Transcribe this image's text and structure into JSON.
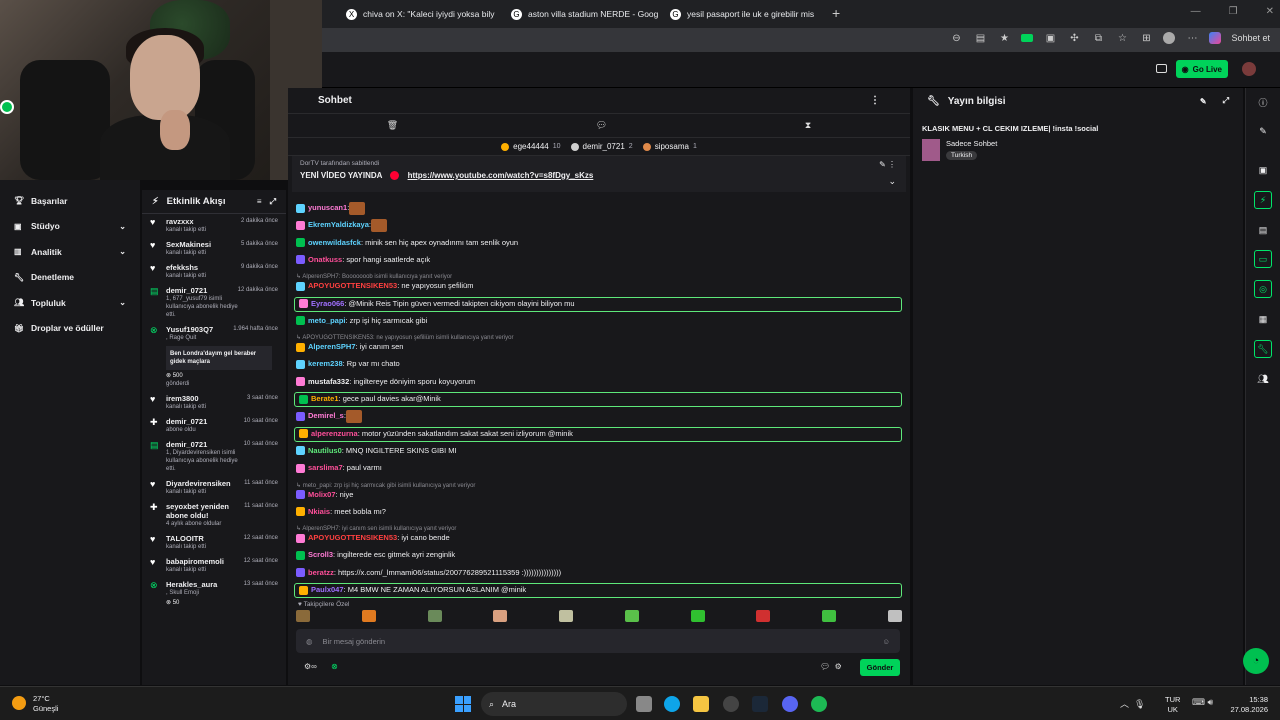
{
  "browser": {
    "tabs": [
      {
        "label": "chiva on X: \"Kaleci iyiydi yoksa bily",
        "icon": "x-icon"
      },
      {
        "label": "aston villa stadium NERDE - Goog",
        "icon": "google-icon"
      },
      {
        "label": "yesil pasaport ile uk e girebilir mis",
        "icon": "google-icon"
      }
    ],
    "new_tab": "+",
    "profile_label": "Sohbet et"
  },
  "header": {
    "go_live": "Go Live"
  },
  "sidebar": {
    "items": [
      {
        "label": "Başarılar",
        "icon": "trophy-icon",
        "chevron": false
      },
      {
        "label": "Stüdyo",
        "icon": "studio-icon",
        "chevron": true
      },
      {
        "label": "Analitik",
        "icon": "chart-icon",
        "chevron": true
      },
      {
        "label": "Denetleme",
        "icon": "wrench-icon",
        "chevron": false
      },
      {
        "label": "Topluluk",
        "icon": "community-icon",
        "chevron": true
      },
      {
        "label": "Droplar ve ödüller",
        "icon": "gift-icon",
        "chevron": false
      }
    ]
  },
  "feed": {
    "title": "Etkinlik Akışı",
    "items": [
      {
        "icon": "heart-icon",
        "name": "ravzxxx",
        "sub": "kanalı takip etti",
        "time": "2 dakika önce"
      },
      {
        "icon": "heart-icon",
        "name": "SexMakinesi",
        "sub": "kanalı takip etti",
        "time": "5 dakika önce"
      },
      {
        "icon": "heart-icon",
        "name": "efekkshs",
        "sub": "kanalı takip etti",
        "time": "9 dakika önce"
      },
      {
        "icon": "gift-icon",
        "name": "demir_0721",
        "sub": "1, 677_yusuf79 isimli kullanıcıya abonelik hediye etti.",
        "time": "12 dakika önce"
      },
      {
        "icon": "bits-icon",
        "name": "Yusuf1903Q7",
        "sub": ", Rage Quit",
        "time": "1.964 hafta önce",
        "message": "Ben Londra'dayım gel beraber gidek maçlara",
        "amount": "500",
        "note": "gönderdi"
      },
      {
        "icon": "heart-icon",
        "name": "irem3800",
        "sub": "kanalı takip etti",
        "time": "3 saat önce"
      },
      {
        "icon": "star-icon",
        "name": "demir_0721",
        "sub": "abone oldu",
        "time": "10 saat önce"
      },
      {
        "icon": "gift-icon",
        "name": "demir_0721",
        "sub": "1, Diyardeviren­siken isimli kullanıcıya abonelik hediye etti.",
        "time": "10 saat önce"
      },
      {
        "icon": "heart-icon",
        "name": "Diyardevirensiken",
        "sub": "kanalı takip etti",
        "time": "11 saat önce"
      },
      {
        "icon": "star-icon",
        "name": "seyoxbet yeniden abone oldu!",
        "sub": "4 aylık abone oldular",
        "time": "11 saat önce"
      },
      {
        "icon": "heart-icon",
        "name": "TALOOITR",
        "sub": "kanalı takip etti",
        "time": "12 saat önce"
      },
      {
        "icon": "heart-icon",
        "name": "babapiromemoli",
        "sub": "kanalı takip etti",
        "time": "12 saat önce"
      },
      {
        "icon": "bits-icon",
        "name": "Herakles_aura",
        "sub": ", Skull Emoji",
        "time": "13 saat önce",
        "amount": "50"
      }
    ]
  },
  "chat": {
    "title": "Sohbet",
    "leaders": [
      {
        "name": "ege44444",
        "count": "10"
      },
      {
        "name": "demir_0721",
        "count": "2"
      },
      {
        "name": "siposama",
        "count": "1"
      }
    ],
    "pinned_by": "DorTV tarafından sabitlendi",
    "pinned_title": "YENİ VİDEO YAYINDA",
    "pinned_link": "https://www.youtube.com/watch?v=s8fDgy_sKzs",
    "messages": [
      {
        "user": "yunuscan1",
        "color": "#ff7bd5",
        "text": ":",
        "emote": true,
        "type": "normal"
      },
      {
        "user": "EkremYaldizkaya",
        "color": "#5ed3ff",
        "text": ":",
        "emote": true,
        "type": "normal"
      },
      {
        "user": "owenwildasfck",
        "color": "#5ed3ff",
        "text": ": minik sen hiç apex oynadınmı tam senlik oyun",
        "type": "normal"
      },
      {
        "user": "Onatkuss",
        "color": "#ff4f9a",
        "text": ": spor hangi saatlerde açık",
        "type": "normal"
      },
      {
        "user": "",
        "color": "",
        "text": "↳ AlperenSPH7: Booooooob isimli kullanıcıya yanıt veriyor",
        "type": "reply"
      },
      {
        "user": "APOYUGOTTENSIKEN53",
        "color": "#ff4040",
        "text": ": ne yapıyosun şefiliüm",
        "type": "normal"
      },
      {
        "user": "Eyrao066",
        "color": "#a070ff",
        "text": ": @Minik Reis Tipin güven vermedi takipten cikiyom olayini biliyon mu",
        "type": "highlight"
      },
      {
        "user": "meto_papi",
        "color": "#5ed3ff",
        "text": ": zrp işi hiç sarmıcak gibi",
        "type": "normal"
      },
      {
        "user": "",
        "color": "",
        "text": "↳ APOYUGOTTENSIKEN53: ne yapıyosun şefiliüm isimli kullanıcıya yanıt veriyor",
        "type": "reply"
      },
      {
        "user": "AlperenSPH7",
        "color": "#5ed3ff",
        "text": ": iyi canım sen",
        "type": "normal"
      },
      {
        "user": "kerem238",
        "color": "#5ed3ff",
        "text": ": Rp var mı chato",
        "type": "normal"
      },
      {
        "user": "mustafa332",
        "color": "#efeff1",
        "text": ": ingiltereye döniyim sporu koyuyorum",
        "type": "normal"
      },
      {
        "user": "Berate1",
        "color": "#ffb000",
        "text": ": gece paul davies akar@Minik",
        "type": "highlight"
      },
      {
        "user": "Demirel_s",
        "color": "#ff7bd5",
        "text": ":",
        "emote": true,
        "type": "normal"
      },
      {
        "user": "alperenzurna",
        "color": "#ff4f9a",
        "text": ": motor yüzünden sakatlandım sakat sakat seni izliyorum @minik",
        "type": "highlight"
      },
      {
        "user": "Nautilus0",
        "color": "#5ee87a",
        "text": ": MNQ INGILTERE SKINS GIBI MI",
        "type": "normal"
      },
      {
        "user": "sarslima7",
        "color": "#ff4f9a",
        "text": ": paul varmı",
        "type": "normal"
      },
      {
        "user": "",
        "color": "",
        "text": "↳ meto_papi: zrp işi hiç sarmıcak gibi isimli kullanıcıya yanıt veriyor",
        "type": "reply"
      },
      {
        "user": "Molix07",
        "color": "#ff4f9a",
        "text": ": niye",
        "type": "normal"
      },
      {
        "user": "Nkiais",
        "color": "#ff4f9a",
        "text": ": meet bobla mı?",
        "type": "normal"
      },
      {
        "user": "",
        "color": "",
        "text": "↳ AlperenSPH7: iyi canım sen isimli kullanıcıya yanıt veriyor",
        "type": "reply"
      },
      {
        "user": "APOYUGOTTENSIKEN53",
        "color": "#ff4040",
        "text": ": iyi cano bende",
        "type": "normal"
      },
      {
        "user": "Scroll3",
        "color": "#ff7bd5",
        "text": ": ingilterede esc gitmek ayri zenginlik",
        "type": "normal"
      },
      {
        "user": "beratzz",
        "color": "#ff4f9a",
        "text": ": https://x.com/_lmmami06/status/2007762895211153​59 :)))))))))))))))",
        "type": "normal"
      },
      {
        "user": "Paulx047",
        "color": "#a070ff",
        "text": ": M4 BMW NE ZAMAN ALIYORSUN ASLANIM @minik",
        "type": "highlight"
      }
    ],
    "followers_only": "Takipçilere Özel",
    "input_placeholder": "Bir mesaj gönderin",
    "send_label": "Gönder"
  },
  "info": {
    "title": "Yayın bilgisi",
    "stream_title": "KLASIK MENU + CL CEKIM IZLEME| !insta !social",
    "category": "Sadece Sohbet",
    "tag": "Turkish"
  },
  "taskbar": {
    "weather_temp": "27°C",
    "weather_desc": "Güneşli",
    "search": "Ara",
    "lang1": "TUR",
    "lang2": "UK",
    "time": "15:38",
    "date": "27.08.2026"
  }
}
